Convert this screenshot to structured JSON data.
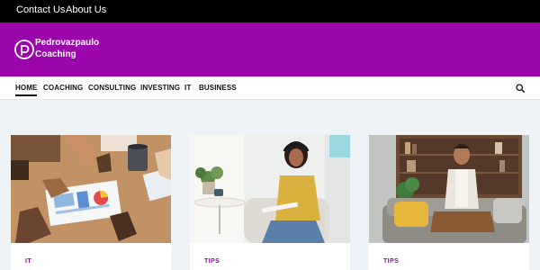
{
  "topbar": {
    "links": [
      "Contact Us",
      "About Us"
    ]
  },
  "brand": {
    "line1": "Pedrovazpaulo",
    "line2": "Coaching",
    "color": "#9a06ab"
  },
  "nav": {
    "items": [
      "HOME",
      "COACHING",
      "CONSULTING",
      "INVESTING",
      "IT",
      "BUSINESS"
    ],
    "active": "HOME",
    "search_icon": "search-icon"
  },
  "posts": [
    {
      "category": "IT",
      "image": "team-meeting-charts"
    },
    {
      "category": "TIPS",
      "image": "woman-headphones-notebook"
    },
    {
      "category": "TIPS",
      "image": "man-meditating-sofa"
    }
  ]
}
